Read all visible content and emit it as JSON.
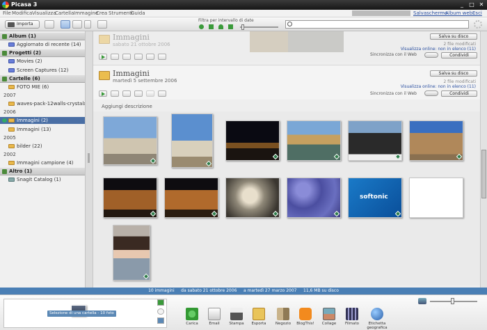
{
  "window": {
    "title": "Picasa 3",
    "minimize": "_",
    "maximize": "□",
    "close": "✕"
  },
  "menu": [
    "File",
    "Modifica",
    "Visualizza",
    "Cartella",
    "Immagine",
    "Crea",
    "Strumenti",
    "Guida"
  ],
  "top_links": [
    "Salvaschermo",
    "Album web",
    "Esci"
  ],
  "toolbar": {
    "import_label": "Importa",
    "filter_label": "Filtra per intervallo di date",
    "search_value": ""
  },
  "sidebar": {
    "sections": [
      {
        "label": "Album (1)",
        "items": [
          {
            "label": "Aggiornato di recente (14)"
          }
        ]
      },
      {
        "label": "Progetti (2)",
        "items": [
          {
            "label": "Movies (2)"
          },
          {
            "label": "Screen Captures (12)"
          }
        ]
      },
      {
        "label": "Cartelle (6)"
      },
      {
        "label": "Altro (1)",
        "items": [
          {
            "label": "Snagit Catalog (1)"
          }
        ]
      }
    ],
    "folders": [
      {
        "label": "FOTO MIE (6)"
      },
      {
        "year": "2007"
      },
      {
        "label": "waves-pack-12walls-crystalxp"
      },
      {
        "year": "2006"
      },
      {
        "label": "Immagini (2)",
        "selected": true
      },
      {
        "label": "Immagini (13)"
      },
      {
        "year": "2005"
      },
      {
        "label": "bilder (22)"
      },
      {
        "year": "2002"
      },
      {
        "label": "Immagini campione (4)"
      }
    ]
  },
  "albums": [
    {
      "title": "Immagini",
      "date": "sabato 21 ottobre 2006",
      "save_label": "Salva su disco",
      "status": "2 file modificati",
      "online": "Visualizza online: non in elenco (11)",
      "sync": "Sincronizza con il Web",
      "share": "Condividi"
    },
    {
      "title": "Immagini",
      "date": "martedì 5 settembre 2006",
      "save_label": "Salva su disco",
      "status": "2 file modificati",
      "online": "Visualizza online: non in elenco (11)",
      "sync": "Sincronizza con il Web",
      "share": "Condividi",
      "description": "Aggiungi descrizione"
    }
  ],
  "statusbar": {
    "count": "10 immagini",
    "from": "da sabato 21 ottobre 2006",
    "to": "a martedì 27 marzo 2007",
    "size": "11,6 MB su disco"
  },
  "tray": {
    "selection": "Selezione di una cartella - 10 foto"
  },
  "tools": [
    "Carica",
    "Email",
    "Stampa",
    "Esporta",
    "Negozio",
    "BlogThis!",
    "Collage",
    "Filmato",
    "Etichetta geografica"
  ],
  "photo_labels": {
    "softonic": "softonic"
  },
  "colors": {
    "statusbar": "#4a7fb5",
    "selection": "#4a6fa5",
    "accent_link": "#2a4fa0"
  }
}
